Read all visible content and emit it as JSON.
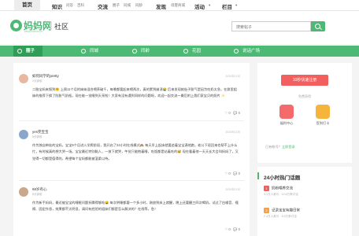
{
  "topnav": {
    "home": "首页",
    "knowledge": "知识",
    "knowledge_sub": [
      "问答",
      "百科"
    ],
    "exchange": "交流",
    "exchange_sub": [
      "圈子",
      "同城",
      "同龄"
    ],
    "discover": "发现",
    "discover_sub": "母婴商城",
    "activity": "活动",
    "column": "栏目"
  },
  "header": {
    "logo": "妈妈网",
    "logo_url": "www.mama.cn",
    "section": "社区",
    "search_placeholder": "搜索帖子"
  },
  "greenbar": {
    "tabs": [
      "圈子",
      "同城",
      "同龄",
      "花园",
      "说话广场"
    ]
  },
  "posts": [
    {
      "author": "如何同学的pretty",
      "time": "2分钟前",
      "date": "2020年12月",
      "text": "二胎宝妈来报到🤗 上周11个月的妹妹混合喂养破千，每晚都要起来喂两次，真的累到崩溃😭 后来发现她肚子胀气是因为吃奶太急，在群里姐妹的推荐下换了防胀气奶瓶，现在能一觉睡到天亮啦！大家有没有遇到同样的问题呀，欢迎一起交流～最后附上我们家宝贝的照片 ✨",
      "likes": "0",
      "comments": "0"
    },
    {
      "author": "yes完宝宝",
      "time": "5分钟前",
      "date": "2020年12月",
      "text": "作为独自带娃的宝妈，宝宝9个月进入学爬阶段，我开启了24小时在线模式🙈 每天早上起床就要追着宝宝满地跑，老公下班回来也帮不上什么忙，有时候真的想大哭一场。宝宝最近特别黏人，一放下就哭，午觉只能抱着睡，吃饭都是站着吃的😅 现在看着他一天天长大会叫妈妈了，又觉得一切都是值得的，希望每个宝妈都能被温柔以待。",
      "likes": "0",
      "comments": "0"
    },
    {
      "author": "68岁有心",
      "time": "8分钟前",
      "date": "2020年12月",
      "text": "作为新手妈妈，最近被宝宝的睡眠问题折腾得够呛😩 每次哄睡都要一个多小时，刚放到床上就醒，晚上还要醒三四次喝奶。试过了白噪音、襁褓、固定作息，效果都不太明显，请问有经验的姐妹们都是怎么解决的？在线等，急！",
      "likes": "0",
      "comments": "0"
    }
  ],
  "sidebar": {
    "post_button": "10秒快速注册",
    "free_label": "免费获得",
    "shortcuts": [
      {
        "label": "福利中心",
        "color": "#f56b6b"
      },
      {
        "label": "签到打卡",
        "color": "#f5b43c"
      }
    ],
    "subtitle_prefix": "已有帐号？",
    "subtitle_link": "立即登录"
  },
  "hot": {
    "title": "24小时热门话题",
    "items": [
      {
        "rank": "1",
        "title": "奶粉喂养交流",
        "sub": "3.1万人参与 · 12.6万条讨论",
        "color": "#f25f5f"
      },
      {
        "rank": "2",
        "title": "记录宝宝有趣日常",
        "sub": "2.4万人参与 · 8.3万条讨论",
        "color": "#f5a14a"
      }
    ]
  },
  "colors": {
    "brand_green": "#4cba74",
    "post_red": "#f25f5f"
  }
}
